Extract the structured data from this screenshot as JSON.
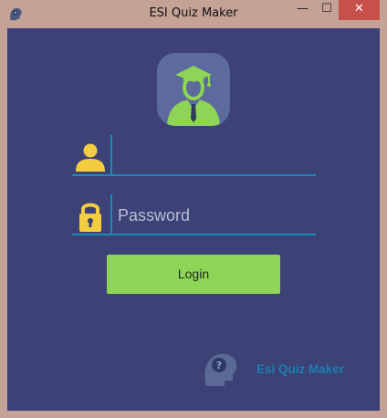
{
  "window": {
    "title": "ESI Quiz Maker",
    "icon": "brain-head-icon",
    "buttons": {
      "minimize": "—",
      "maximize": "☐",
      "close": "✕"
    }
  },
  "avatar": {
    "icon": "graduate-user-icon"
  },
  "username": {
    "value": "",
    "placeholder": "",
    "icon": "user-icon"
  },
  "password": {
    "value": "",
    "placeholder": "Password",
    "icon": "lock-icon"
  },
  "login_button": {
    "label": "Login"
  },
  "brand": {
    "text": "Esi Quiz Maker",
    "icon": "brain-head-icon"
  },
  "colors": {
    "background": "#3c4176",
    "accent_line": "#1c8ab8",
    "button": "#8ed456",
    "icon_yellow": "#f4cc3f",
    "brand_text": "#1f7fad"
  }
}
